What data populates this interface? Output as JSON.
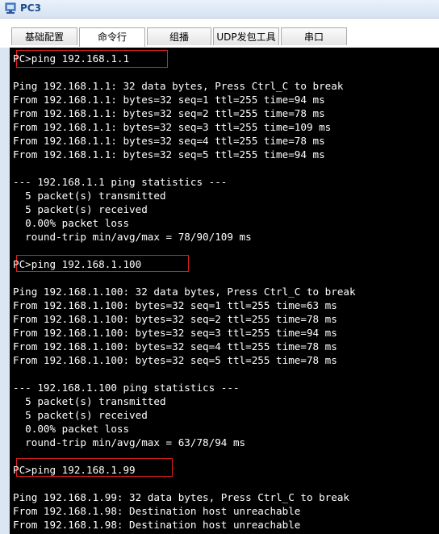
{
  "window": {
    "title": "PC3",
    "icon": "pc-app-icon"
  },
  "tabs": [
    {
      "label": "基础配置"
    },
    {
      "label": "命令行"
    },
    {
      "label": "组播"
    },
    {
      "label": "UDP发包工具"
    },
    {
      "label": "串口"
    }
  ],
  "active_tab": "命令行",
  "terminal": {
    "lines": [
      "PC>ping 192.168.1.1",
      "",
      "Ping 192.168.1.1: 32 data bytes, Press Ctrl_C to break",
      "From 192.168.1.1: bytes=32 seq=1 ttl=255 time=94 ms",
      "From 192.168.1.1: bytes=32 seq=2 ttl=255 time=78 ms",
      "From 192.168.1.1: bytes=32 seq=3 ttl=255 time=109 ms",
      "From 192.168.1.1: bytes=32 seq=4 ttl=255 time=78 ms",
      "From 192.168.1.1: bytes=32 seq=5 ttl=255 time=94 ms",
      "",
      "--- 192.168.1.1 ping statistics ---",
      "  5 packet(s) transmitted",
      "  5 packet(s) received",
      "  0.00% packet loss",
      "  round-trip min/avg/max = 78/90/109 ms",
      "",
      "PC>ping 192.168.1.100",
      "",
      "Ping 192.168.1.100: 32 data bytes, Press Ctrl_C to break",
      "From 192.168.1.100: bytes=32 seq=1 ttl=255 time=63 ms",
      "From 192.168.1.100: bytes=32 seq=2 ttl=255 time=78 ms",
      "From 192.168.1.100: bytes=32 seq=3 ttl=255 time=94 ms",
      "From 192.168.1.100: bytes=32 seq=4 ttl=255 time=78 ms",
      "From 192.168.1.100: bytes=32 seq=5 ttl=255 time=78 ms",
      "",
      "--- 192.168.1.100 ping statistics ---",
      "  5 packet(s) transmitted",
      "  5 packet(s) received",
      "  0.00% packet loss",
      "  round-trip min/avg/max = 63/78/94 ms",
      "",
      "PC>ping 192.168.1.99",
      "",
      "Ping 192.168.1.99: 32 data bytes, Press Ctrl_C to break",
      "From 192.168.1.98: Destination host unreachable",
      "From 192.168.1.98: Destination host unreachable"
    ]
  },
  "colors": {
    "terminal_bg": "#000000",
    "terminal_fg": "#ffffff",
    "highlight_box": "#e02020",
    "title_text": "#1c4d8c"
  }
}
